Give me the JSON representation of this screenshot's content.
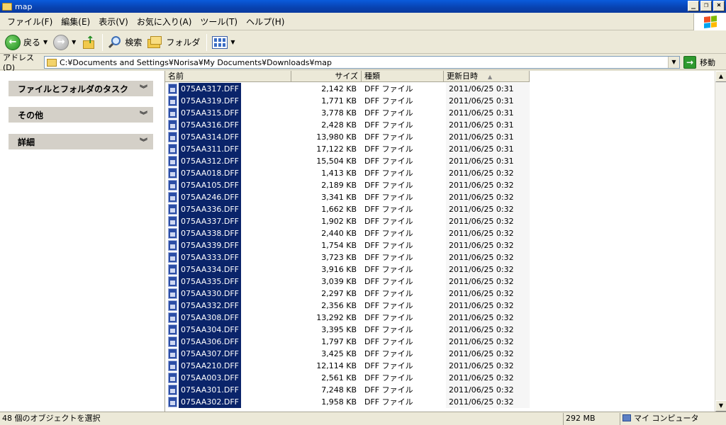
{
  "window": {
    "title": "map"
  },
  "menu": [
    "ファイル(F)",
    "編集(E)",
    "表示(V)",
    "お気に入り(A)",
    "ツール(T)",
    "ヘルプ(H)"
  ],
  "toolbar": {
    "back_label": "戻る",
    "search_label": "検索",
    "folders_label": "フォルダ"
  },
  "address": {
    "label": "アドレス(D)",
    "path": "C:¥Documents and Settings¥Norisa¥My Documents¥Downloads¥map",
    "go_label": "移動"
  },
  "tasks": [
    "ファイルとフォルダのタスク",
    "その他",
    "詳細"
  ],
  "columns": {
    "name": "名前",
    "size": "サイズ",
    "type": "種類",
    "modified": "更新日時"
  },
  "files": [
    {
      "name": "075AA317.DFF",
      "size": "2,142 KB",
      "type": "DFF ファイル",
      "modified": "2011/06/25 0:31"
    },
    {
      "name": "075AA319.DFF",
      "size": "1,771 KB",
      "type": "DFF ファイル",
      "modified": "2011/06/25 0:31"
    },
    {
      "name": "075AA315.DFF",
      "size": "3,778 KB",
      "type": "DFF ファイル",
      "modified": "2011/06/25 0:31"
    },
    {
      "name": "075AA316.DFF",
      "size": "2,428 KB",
      "type": "DFF ファイル",
      "modified": "2011/06/25 0:31"
    },
    {
      "name": "075AA314.DFF",
      "size": "13,980 KB",
      "type": "DFF ファイル",
      "modified": "2011/06/25 0:31"
    },
    {
      "name": "075AA311.DFF",
      "size": "17,122 KB",
      "type": "DFF ファイル",
      "modified": "2011/06/25 0:31"
    },
    {
      "name": "075AA312.DFF",
      "size": "15,504 KB",
      "type": "DFF ファイル",
      "modified": "2011/06/25 0:31"
    },
    {
      "name": "075AA018.DFF",
      "size": "1,413 KB",
      "type": "DFF ファイル",
      "modified": "2011/06/25 0:32"
    },
    {
      "name": "075AA105.DFF",
      "size": "2,189 KB",
      "type": "DFF ファイル",
      "modified": "2011/06/25 0:32"
    },
    {
      "name": "075AA246.DFF",
      "size": "3,341 KB",
      "type": "DFF ファイル",
      "modified": "2011/06/25 0:32"
    },
    {
      "name": "075AA336.DFF",
      "size": "1,662 KB",
      "type": "DFF ファイル",
      "modified": "2011/06/25 0:32"
    },
    {
      "name": "075AA337.DFF",
      "size": "1,902 KB",
      "type": "DFF ファイル",
      "modified": "2011/06/25 0:32"
    },
    {
      "name": "075AA338.DFF",
      "size": "2,440 KB",
      "type": "DFF ファイル",
      "modified": "2011/06/25 0:32"
    },
    {
      "name": "075AA339.DFF",
      "size": "1,754 KB",
      "type": "DFF ファイル",
      "modified": "2011/06/25 0:32"
    },
    {
      "name": "075AA333.DFF",
      "size": "3,723 KB",
      "type": "DFF ファイル",
      "modified": "2011/06/25 0:32"
    },
    {
      "name": "075AA334.DFF",
      "size": "3,916 KB",
      "type": "DFF ファイル",
      "modified": "2011/06/25 0:32"
    },
    {
      "name": "075AA335.DFF",
      "size": "3,039 KB",
      "type": "DFF ファイル",
      "modified": "2011/06/25 0:32"
    },
    {
      "name": "075AA330.DFF",
      "size": "2,297 KB",
      "type": "DFF ファイル",
      "modified": "2011/06/25 0:32"
    },
    {
      "name": "075AA332.DFF",
      "size": "2,356 KB",
      "type": "DFF ファイル",
      "modified": "2011/06/25 0:32"
    },
    {
      "name": "075AA308.DFF",
      "size": "13,292 KB",
      "type": "DFF ファイル",
      "modified": "2011/06/25 0:32"
    },
    {
      "name": "075AA304.DFF",
      "size": "3,395 KB",
      "type": "DFF ファイル",
      "modified": "2011/06/25 0:32"
    },
    {
      "name": "075AA306.DFF",
      "size": "1,797 KB",
      "type": "DFF ファイル",
      "modified": "2011/06/25 0:32"
    },
    {
      "name": "075AA307.DFF",
      "size": "3,425 KB",
      "type": "DFF ファイル",
      "modified": "2011/06/25 0:32"
    },
    {
      "name": "075AA210.DFF",
      "size": "12,114 KB",
      "type": "DFF ファイル",
      "modified": "2011/06/25 0:32"
    },
    {
      "name": "075AA003.DFF",
      "size": "2,561 KB",
      "type": "DFF ファイル",
      "modified": "2011/06/25 0:32"
    },
    {
      "name": "075AA301.DFF",
      "size": "7,248 KB",
      "type": "DFF ファイル",
      "modified": "2011/06/25 0:32"
    },
    {
      "name": "075AA302.DFF",
      "size": "1,958 KB",
      "type": "DFF ファイル",
      "modified": "2011/06/25 0:32"
    }
  ],
  "status": {
    "selection": "48 個のオブジェクトを選択",
    "size": "292 MB",
    "location": "マイ コンピュータ"
  },
  "icons": {
    "window": "folder-icon",
    "back": "back-arrow-icon",
    "forward": "forward-arrow-icon",
    "up": "folder-up-icon",
    "search": "search-icon",
    "folders": "folders-icon",
    "views": "views-icon",
    "go": "go-arrow-icon",
    "file": "dff-file-icon",
    "computer": "computer-icon",
    "windows_logo": "windows-logo-icon"
  },
  "colors": {
    "title_bar": "#0842b0",
    "selection": "#0a246a",
    "chrome": "#ece9d8",
    "task_header": "#d4d0c8"
  }
}
